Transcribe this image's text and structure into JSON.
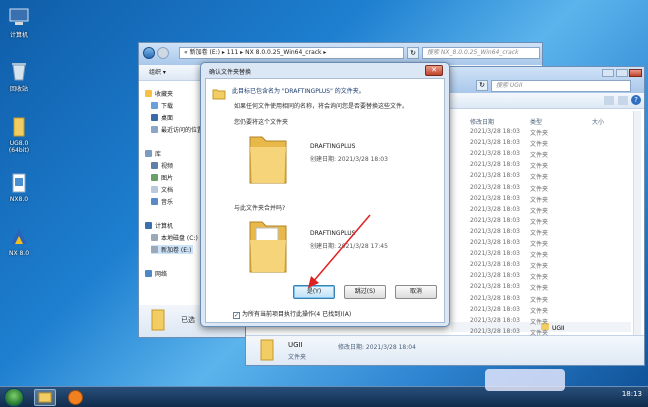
{
  "desktop": {
    "icons": [
      {
        "label": "计算机"
      },
      {
        "label": "回收站"
      },
      {
        "label": "UG8.0 (64bit)"
      },
      {
        "label": "NX8.0"
      },
      {
        "label": "NX 8.0"
      }
    ]
  },
  "back_window": {
    "address": "« 新加卷 (E:) ▸ 111 ▸ NX 8.0.0.25_Win64_crack ▸",
    "search_placeholder": "搜索 NX_8.0.0.25_Win64_crack",
    "toolbar": {
      "organize": "组织 ▾"
    },
    "nav": {
      "favorites": "收藏夹",
      "downloads": "下载",
      "desktop": "桌面",
      "recent": "最近访问的位置",
      "libraries": "库",
      "videos": "视频",
      "pictures": "图片",
      "documents": "文档",
      "music": "音乐",
      "computer": "计算机",
      "local_disk": "本地磁盘 (C:)",
      "new_volume": "新加卷 (E:)",
      "network": "网络"
    },
    "status_partial": "已选"
  },
  "front_window": {
    "search_placeholder": "搜索 UGII",
    "columns": {
      "modified": "修改日期",
      "type": "类型",
      "size": "大小"
    },
    "rows": [
      {
        "date": "2021/3/28 18:03",
        "type": "文件夹"
      },
      {
        "date": "2021/3/28 18:03",
        "type": "文件夹"
      },
      {
        "date": "2021/3/28 18:03",
        "type": "文件夹"
      },
      {
        "date": "2021/3/28 18:03",
        "type": "文件夹"
      },
      {
        "date": "2021/3/28 18:03",
        "type": "文件夹"
      },
      {
        "date": "2021/3/28 18:03",
        "type": "文件夹"
      },
      {
        "date": "2021/3/28 18:03",
        "type": "文件夹"
      },
      {
        "date": "2021/3/28 18:03",
        "type": "文件夹"
      },
      {
        "date": "2021/3/28 18:03",
        "type": "文件夹"
      },
      {
        "date": "2021/3/28 18:03",
        "type": "文件夹"
      },
      {
        "date": "2021/3/28 18:03",
        "type": "文件夹"
      },
      {
        "date": "2021/3/28 18:03",
        "type": "文件夹"
      },
      {
        "date": "2021/3/28 18:03",
        "type": "文件夹"
      },
      {
        "date": "2021/3/28 18:03",
        "type": "文件夹"
      },
      {
        "date": "2021/3/28 18:03",
        "type": "文件夹"
      },
      {
        "date": "2021/3/28 18:03",
        "type": "文件夹"
      },
      {
        "date": "2021/3/28 18:03",
        "type": "文件夹"
      },
      {
        "date": "2021/3/28 18:03",
        "type": "文件夹"
      },
      {
        "date": "2021/3/28 18:03",
        "type": "文件夹"
      }
    ],
    "partial_row": "UGII",
    "details": {
      "name": "UGII",
      "modified": "修改日期: 2021/3/28 18:04",
      "type": "文件夹"
    }
  },
  "dialog": {
    "title": "确认文件夹替换",
    "message": "此目标已包含名为 \"DRAFTINGPLUS\" 的文件夹。",
    "detail": "如果任何文件使用相同的名称，将会询问您是否要替换这些文件。",
    "question1": "您仍要将这个文件夹",
    "existing": {
      "name": "DRAFTINGPLUS",
      "created": "创建日期: 2021/3/28 18:03"
    },
    "question2": "与此文件夹合并吗?",
    "incoming": {
      "name": "DRAFTINGPLUS",
      "created": "创建日期: 2021/3/28 17:45"
    },
    "buttons": {
      "yes": "是(Y)",
      "skip": "跳过(S)",
      "cancel": "取消"
    },
    "apply_all": "为所有当前项目执行此操作(4 已找到)(A)"
  },
  "taskbar": {
    "clock": "18:13"
  },
  "colors": {
    "accent": "#3c7fb1",
    "folder": "#f2cd63",
    "arrow": "#e02020"
  }
}
